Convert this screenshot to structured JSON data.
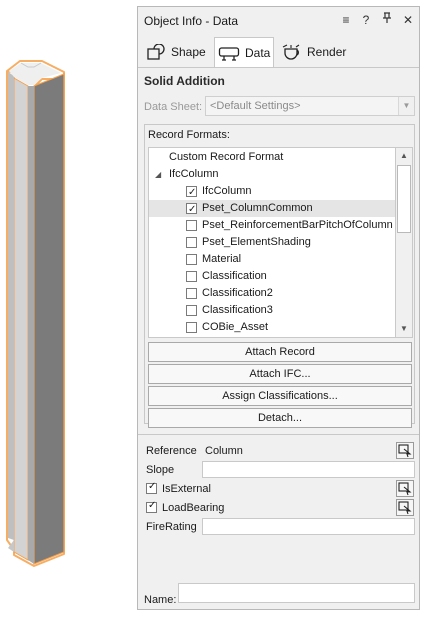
{
  "window": {
    "title": "Object Info - Data"
  },
  "titlebar_buttons": [
    {
      "name": "menu-icon",
      "glyph": "≡"
    },
    {
      "name": "help-icon",
      "glyph": "?"
    },
    {
      "name": "pin-icon",
      "glyph": "⊥"
    },
    {
      "name": "close-icon",
      "glyph": "✕"
    }
  ],
  "tabs": [
    {
      "label": "Shape",
      "icon": "shape-icon",
      "active": false
    },
    {
      "label": "Data",
      "icon": "data-icon",
      "active": true
    },
    {
      "label": "Render",
      "icon": "render-icon",
      "active": false
    }
  ],
  "section": {
    "title": "Solid Addition"
  },
  "data_sheet": {
    "label": "Data Sheet:",
    "value": "<Default Settings>"
  },
  "record_formats": {
    "label": "Record Formats:",
    "items": [
      {
        "label": "Custom Record Format",
        "level": 0,
        "checkbox": false,
        "checked": false,
        "expander": false,
        "selected": false
      },
      {
        "label": "IfcColumn",
        "level": 0,
        "checkbox": false,
        "checked": false,
        "expander": true,
        "selected": false
      },
      {
        "label": "IfcColumn",
        "level": 1,
        "checkbox": true,
        "checked": true,
        "expander": false,
        "selected": false
      },
      {
        "label": "Pset_ColumnCommon",
        "level": 1,
        "checkbox": true,
        "checked": true,
        "expander": false,
        "selected": true
      },
      {
        "label": "Pset_ReinforcementBarPitchOfColumn",
        "level": 1,
        "checkbox": true,
        "checked": false,
        "expander": false,
        "selected": false
      },
      {
        "label": "Pset_ElementShading",
        "level": 1,
        "checkbox": true,
        "checked": false,
        "expander": false,
        "selected": false
      },
      {
        "label": "Material",
        "level": 1,
        "checkbox": true,
        "checked": false,
        "expander": false,
        "selected": false
      },
      {
        "label": "Classification",
        "level": 1,
        "checkbox": true,
        "checked": false,
        "expander": false,
        "selected": false
      },
      {
        "label": "Classification2",
        "level": 1,
        "checkbox": true,
        "checked": false,
        "expander": false,
        "selected": false
      },
      {
        "label": "Classification3",
        "level": 1,
        "checkbox": true,
        "checked": false,
        "expander": false,
        "selected": false
      },
      {
        "label": "COBie_Asset",
        "level": 1,
        "checkbox": true,
        "checked": false,
        "expander": false,
        "selected": false
      }
    ]
  },
  "buttons": {
    "attach_record": "Attach Record",
    "attach_ifc": "Attach IFC...",
    "assign_classifications": "Assign Classifications...",
    "detach": "Detach..."
  },
  "fields": {
    "reference": {
      "label": "Reference",
      "value": "Column"
    },
    "slope": {
      "label": "Slope",
      "value": ""
    },
    "is_external": {
      "label": "IsExternal",
      "checked": true
    },
    "load_bearing": {
      "label": "LoadBearing",
      "checked": true
    },
    "fire_rating": {
      "label": "FireRating",
      "value": ""
    }
  },
  "name_field": {
    "label": "Name:",
    "value": ""
  },
  "colors": {
    "selection_outline": "#f5a04a",
    "column_dark_face": "#777777",
    "column_light_face": "#cfcfcf",
    "panel_bg": "#f0f0f0"
  }
}
